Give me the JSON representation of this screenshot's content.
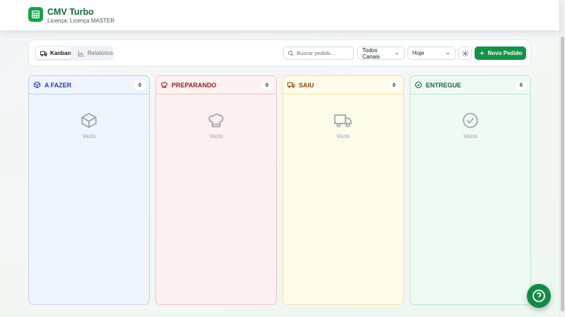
{
  "app": {
    "title": "CMV Turbo",
    "license": "Licença: Licença MASTER",
    "logo_icon": "table-grid-icon",
    "brand_color": "#16a34a"
  },
  "toolbar": {
    "tabs": [
      {
        "label": "Kanban",
        "icon": "truck-icon",
        "active": true
      },
      {
        "label": "Relatórios",
        "icon": "bar-chart-icon",
        "active": false
      }
    ],
    "search_placeholder": "Buscar pedido...",
    "channel_select": "Todos Canais",
    "period_select": "Hoje",
    "settings_icon": "gear-icon",
    "new_order_label": "Novo Pedido",
    "new_order_color": "#15924a"
  },
  "columns": [
    {
      "title": "A FAZER",
      "count": "0",
      "icon": "box-icon",
      "empty_text": "Vazio",
      "color": "#1e40af"
    },
    {
      "title": "PREPARANDO",
      "count": "0",
      "icon": "chef-hat-icon",
      "empty_text": "Vazio",
      "color": "#991b1b"
    },
    {
      "title": "SAIU",
      "count": "0",
      "icon": "truck-icon",
      "empty_text": "Vazio",
      "color": "#854d0e"
    },
    {
      "title": "ENTREGUE",
      "count": "0",
      "icon": "check-circle-icon",
      "empty_text": "Vazio",
      "color": "#166534"
    }
  ],
  "help": {
    "icon": "help-circle-icon"
  }
}
